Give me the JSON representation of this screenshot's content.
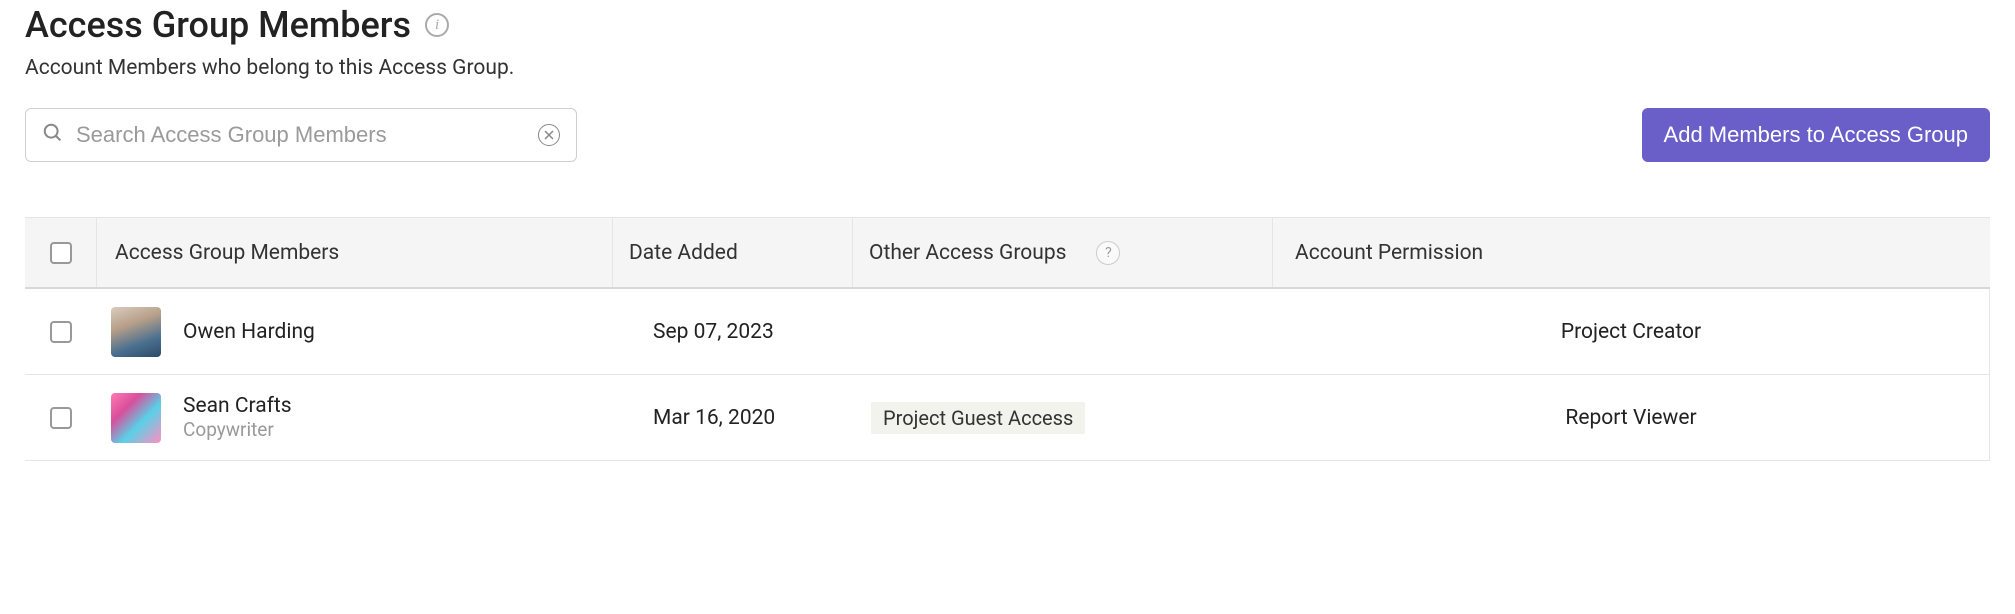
{
  "header": {
    "title": "Access Group Members",
    "subtitle": "Account Members who belong to this Access Group."
  },
  "search": {
    "placeholder": "Search Access Group Members"
  },
  "buttons": {
    "add_members": "Add Members to Access Group"
  },
  "table": {
    "columns": {
      "members": "Access Group Members",
      "date_added": "Date Added",
      "other_groups": "Other Access Groups",
      "permission": "Account Permission"
    },
    "rows": [
      {
        "name": "Owen Harding",
        "role": "",
        "date_added": "Sep 07, 2023",
        "other_groups": "",
        "permission": "Project Creator",
        "avatar_class": "avatar-1"
      },
      {
        "name": "Sean Crafts",
        "role": "Copywriter",
        "date_added": "Mar 16, 2020",
        "other_groups": "Project Guest Access",
        "permission": "Report Viewer",
        "avatar_class": "avatar-2"
      }
    ]
  }
}
